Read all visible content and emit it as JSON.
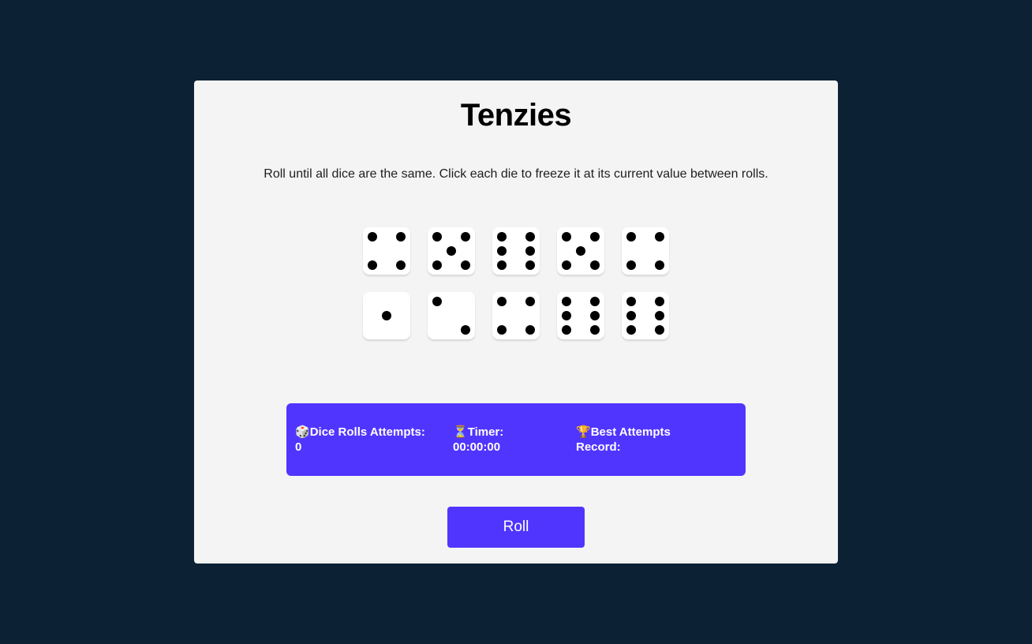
{
  "title": "Tenzies",
  "instructions": "Roll until all dice are the same. Click each die to freeze it at its current value between rolls.",
  "dice": [
    4,
    5,
    6,
    5,
    4,
    1,
    2,
    4,
    6,
    6
  ],
  "stats": {
    "attempts_icon": "🎲",
    "attempts_label": "Dice Rolls Attempts:",
    "attempts_value": "0",
    "timer_icon": "⏳",
    "timer_label": "Timer:",
    "timer_value": "00:00:00",
    "best_icon": "🏆",
    "best_label": "Best Attempts Record:"
  },
  "roll_button_label": "Roll",
  "colors": {
    "background": "#0c2133",
    "card": "#f4f4f4",
    "accent": "#5035ff",
    "pip": "#000000"
  }
}
